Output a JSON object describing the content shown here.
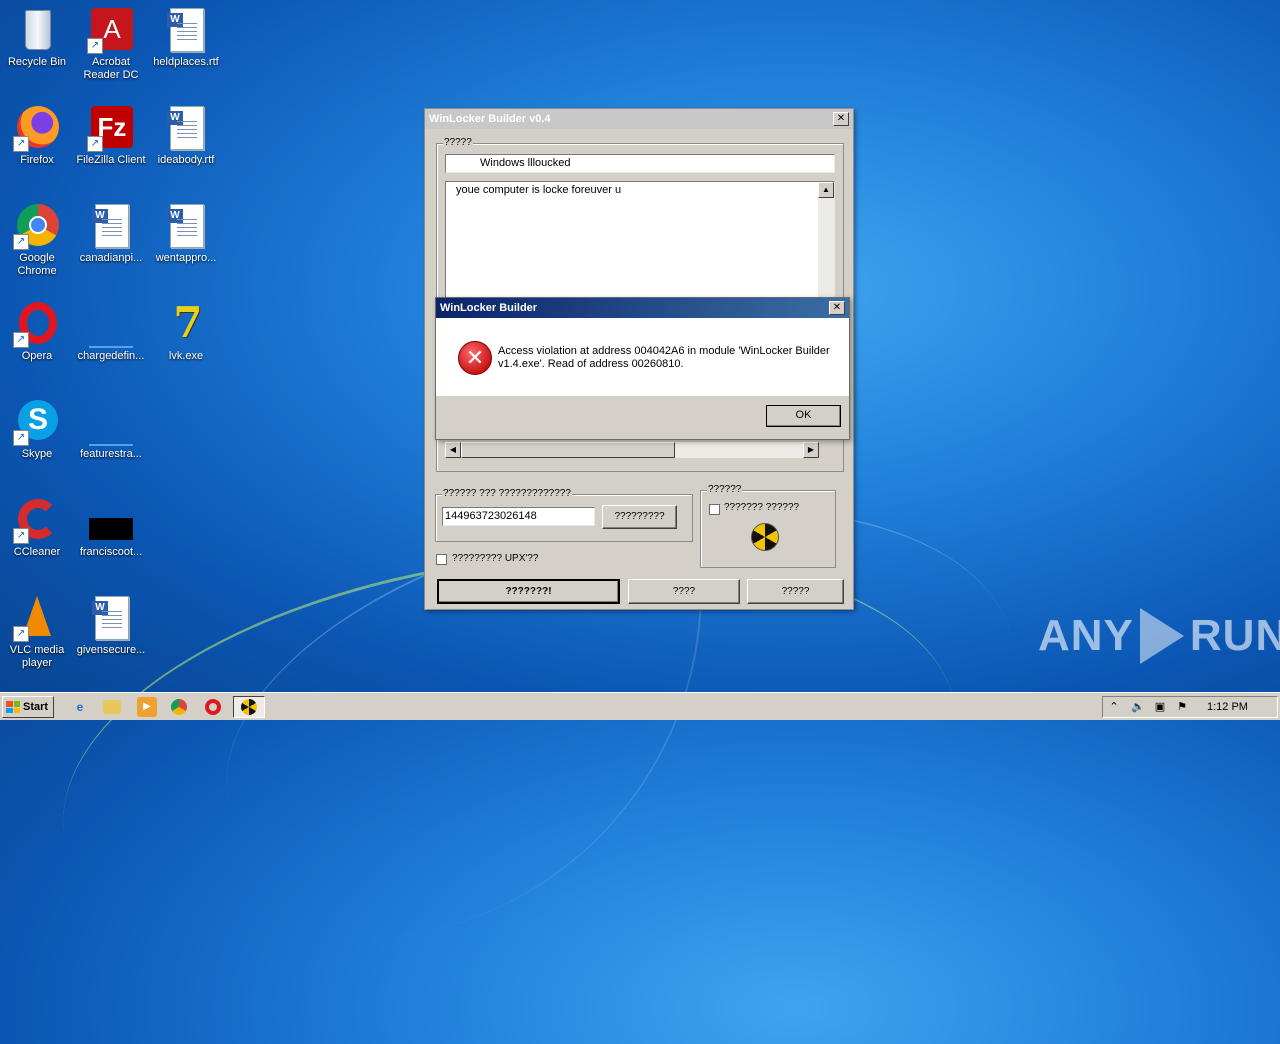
{
  "desktop": {
    "icons": [
      {
        "label": "Recycle Bin"
      },
      {
        "label": "Acrobat Reader DC"
      },
      {
        "label": "heldplaces.rtf"
      },
      {
        "label": "Firefox"
      },
      {
        "label": "FileZilla Client"
      },
      {
        "label": "ideabody.rtf"
      },
      {
        "label": "Google Chrome"
      },
      {
        "label": "canadianpi..."
      },
      {
        "label": "wentappro..."
      },
      {
        "label": "Opera"
      },
      {
        "label": "chargedefin..."
      },
      {
        "label": "lvk.exe"
      },
      {
        "label": "Skype"
      },
      {
        "label": "featurestra..."
      },
      {
        "label": "CCleaner"
      },
      {
        "label": "franciscoot..."
      },
      {
        "label": "VLC media player"
      },
      {
        "label": "givensecure..."
      }
    ]
  },
  "main_window": {
    "title": "WinLocker Builder v0.4",
    "group_text_label": "?????",
    "title_field_value": "Windows llloucked",
    "message_text": "youe computer is locke foreuver u",
    "password_group_label": "?????? ??? ?????????????",
    "password_value": "144963723026148",
    "generate_button": "?????????",
    "options_group_label": "??????",
    "option_checkbox_label": "??????? ??????",
    "upx_checkbox_label": "????????? UPX'??",
    "build_button": "???????!",
    "button_two": "????",
    "button_three": "?????"
  },
  "error_dialog": {
    "title": "WinLocker Builder",
    "message_line1": "Access violation at address 004042A6 in module 'WinLocker Builder",
    "message_line2": "v1.4.exe'. Read of address 00260810.",
    "ok_button": "OK"
  },
  "taskbar": {
    "start_label": "Start",
    "clock": "1:12 PM"
  },
  "watermark": {
    "left": "ANY",
    "right": "RUN"
  }
}
